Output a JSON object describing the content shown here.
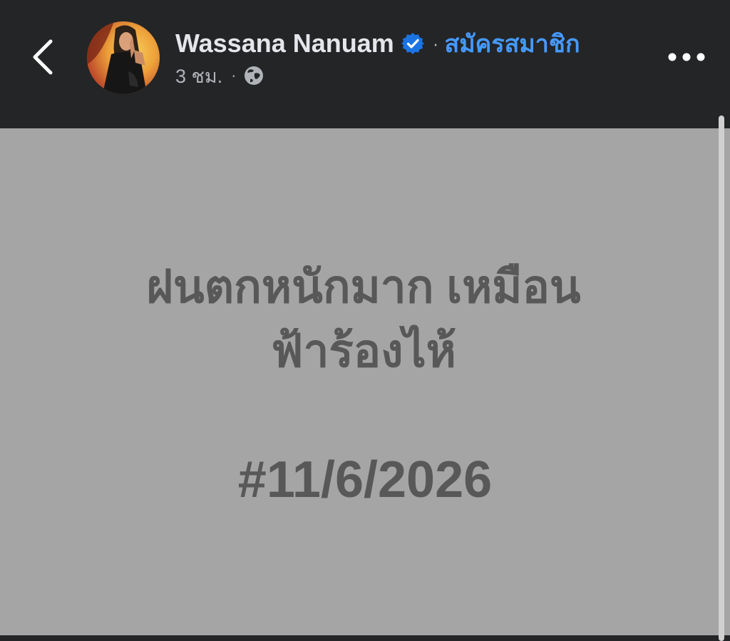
{
  "header": {
    "author_name": "Wassana Nanuam",
    "subscribe_label": "สมัครสมาชิก",
    "time_label": "3 ชม.",
    "separator": "·"
  },
  "post": {
    "line1": "ฝนตกหนักมาก เหมือน",
    "line2": "ฟ้าร้องไห้",
    "hashtag": "#11/6/2026"
  },
  "icons": {
    "back": "chevron-left-icon",
    "verified": "verified-badge-icon",
    "privacy": "globe-icon",
    "more": "more-dots-icon"
  },
  "colors": {
    "header_bg": "#242526",
    "post_bg": "#a5a5a5",
    "post_text": "#585858",
    "link_blue": "#4599ff",
    "verified_blue": "#1b74e4"
  }
}
